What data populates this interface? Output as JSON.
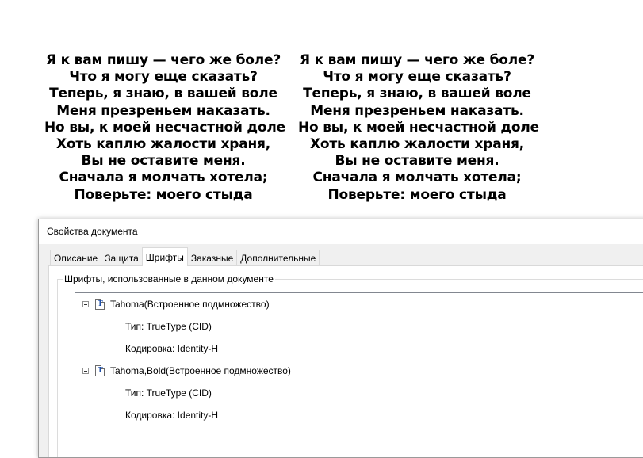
{
  "poem_left": {
    "lines": [
      "Я к вам пишу — чего же боле?",
      "Что я могу еще сказать?",
      "Теперь, я знаю, в вашей воле",
      "Меня презреньем наказать.",
      "Но вы, к моей несчастной доле",
      "Хоть каплю жалости храня,",
      "Вы не оставите меня.",
      "Сначала я молчать хотела;",
      "Поверьте: моего стыда"
    ]
  },
  "poem_right": {
    "lines": [
      "Я к вам пишу — чего же боле?",
      "Что я могу еще сказать?",
      "Теперь, я знаю, в вашей воле",
      "Меня презреньем наказать.",
      "Но вы, к моей несчастной доле",
      "Хоть каплю жалости храня,",
      "Вы не оставите меня.",
      "Сначала я молчать хотела;",
      "Поверьте: моего стыда"
    ]
  },
  "dialog": {
    "title": "Свойства документа",
    "tabs": [
      {
        "label": "Описание",
        "active": false
      },
      {
        "label": "Защита",
        "active": false
      },
      {
        "label": "Шрифты",
        "active": true
      },
      {
        "label": "Заказные",
        "active": false
      },
      {
        "label": "Дополнительные",
        "active": false
      }
    ],
    "group_title": "Шрифты, использованные в данном документе",
    "fonts": [
      {
        "name": "Tahoma(Встроенное подмножество)",
        "type": "Тип: TrueType (CID)",
        "encoding": "Кодировка: Identity-H"
      },
      {
        "name": "Tahoma,Bold(Встроенное подмножество)",
        "type": "Тип: TrueType (CID)",
        "encoding": "Кодировка: Identity-H"
      }
    ],
    "icons": {
      "expander": "collapse-minus-icon",
      "font": "truetype-font-icon"
    }
  }
}
